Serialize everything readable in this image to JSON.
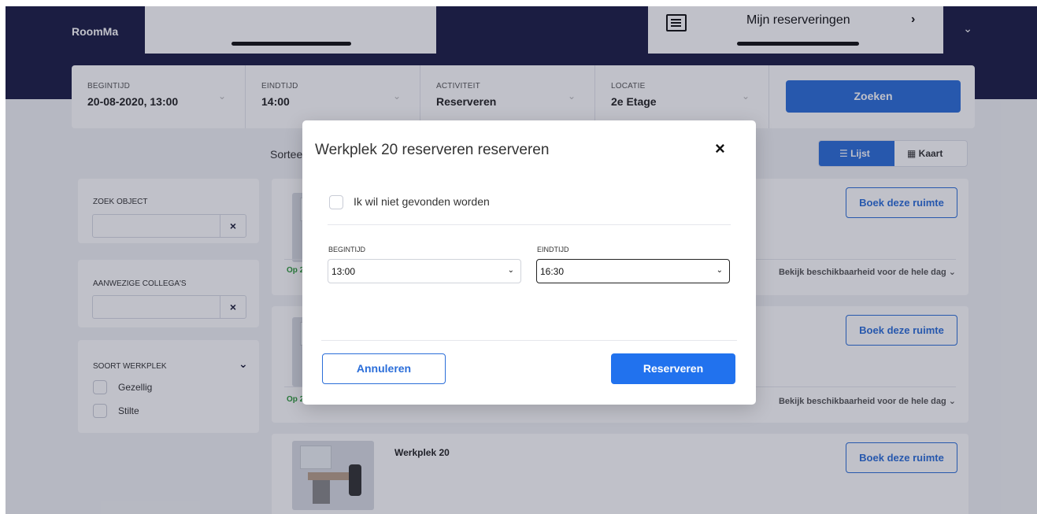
{
  "app": {
    "brand": "RoomMa"
  },
  "phone_overlay": {
    "menu_label": "Mijn reserveringen",
    "menu_arrow": "›"
  },
  "search": {
    "fields": [
      {
        "label": "BEGINTIJD",
        "value": "20-08-2020, 13:00"
      },
      {
        "label": "EINDTIJD",
        "value": "14:00"
      },
      {
        "label": "ACTIVITEIT",
        "value": "Reserveren"
      },
      {
        "label": "LOCATIE",
        "value": "2e Etage"
      }
    ],
    "button": "Zoeken"
  },
  "sort_label": "Sortee",
  "view": {
    "list": "Lijst",
    "map": "Kaart"
  },
  "filters": {
    "object_label": "ZOEK OBJECT",
    "colleagues_label": "AANWEZIGE COLLEGA'S",
    "type_label": "SOORT WERKPLEK",
    "type_options": [
      "Gezellig",
      "Stilte"
    ],
    "clear": "×"
  },
  "results": [
    {
      "title": "",
      "status": "Op 2",
      "book": "Boek deze ruimte",
      "availability": "Bekijk beschikbaarheid voor de hele dag"
    },
    {
      "title": "",
      "status": "Op 2",
      "book": "Boek deze ruimte",
      "availability": "Bekijk beschikbaarheid voor de hele dag"
    },
    {
      "title": "Werkplek 20",
      "status": "",
      "book": "Boek deze ruimte",
      "availability": ""
    }
  ],
  "modal": {
    "title": "Werkplek 20 reserveren reserveren",
    "close": "×",
    "hidden_label": "Ik wil niet gevonden worden",
    "start_label": "BEGINTIJD",
    "start_value": "13:00",
    "end_label": "EINDTIJD",
    "end_value": "16:30",
    "cancel": "Annuleren",
    "confirm": "Reserveren"
  },
  "colors": {
    "navy": "#1b1c44",
    "accent": "#2b6ed9",
    "confirm": "#2172ee",
    "green": "#2d9a3a"
  }
}
